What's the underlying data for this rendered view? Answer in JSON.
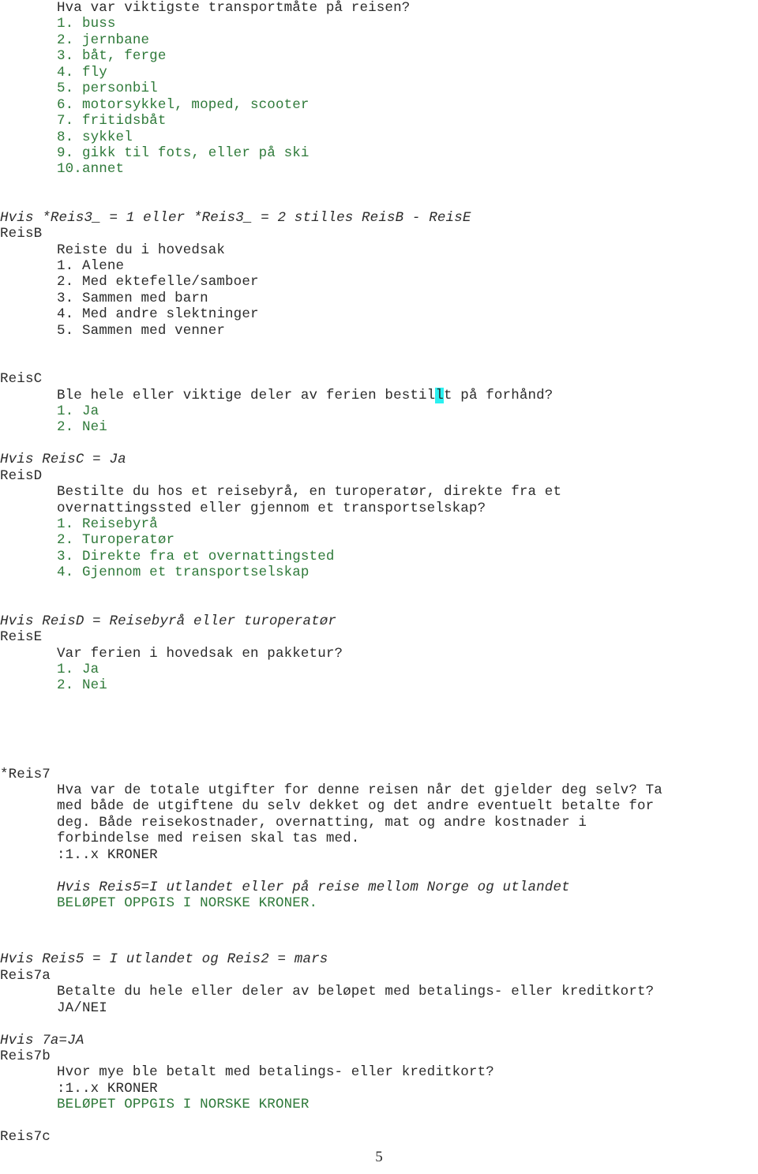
{
  "document": {
    "page_number": "5",
    "language": "no",
    "colors": {
      "text_dark": "#2b2b2b",
      "text_green": "#2f7a3a",
      "highlight_cyan": "#2bf0f0",
      "background": "#ffffff"
    }
  },
  "reisA_tail": {
    "question": "Hva var viktigste transportmåte på reisen?",
    "options": [
      "1. buss",
      "2. jernbane",
      "3. båt, ferge",
      "4. fly",
      "5. personbil",
      "6. motorsykkel, moped, scooter",
      "7. fritidsbåt",
      "8. sykkel",
      "9. gikk til fots, eller på ski",
      "10.annet"
    ]
  },
  "reisB": {
    "condition": "Hvis *Reis3_ = 1 eller *Reis3_ = 2 stilles ReisB - ReisE",
    "label": "ReisB",
    "question": "Reiste du i hovedsak",
    "options": [
      "1. Alene",
      "2. Med ektefelle/samboer",
      "3. Sammen med barn",
      "4. Med andre slektninger",
      "5. Sammen med venner"
    ]
  },
  "reisC": {
    "label": "ReisC",
    "question_pre": "Ble hele eller viktige deler av ferien bestil",
    "question_highlight": "l",
    "question_post": "t på forhånd?",
    "options": [
      "1. Ja",
      "2. Nei"
    ]
  },
  "reisD": {
    "condition": "Hvis ReisC = Ja",
    "label": "ReisD",
    "question_line1": "Bestilte du hos et reisebyrå, en turoperatør, direkte fra et",
    "question_line2": "overnattingssted eller gjennom et transportselskap?",
    "options": [
      "1. Reisebyrå",
      "2. Turoperatør",
      "3. Direkte fra et overnattingsted",
      "4. Gjennom et transportselskap"
    ]
  },
  "reisE": {
    "condition": "Hvis ReisD = Reisebyrå eller turoperatør",
    "label": "ReisE",
    "question": "Var ferien i hovedsak en pakketur?",
    "options": [
      "1. Ja",
      "2. Nei"
    ]
  },
  "reis7": {
    "label": "*Reis7",
    "question_line1": "Hva var de totale utgifter for denne reisen når det gjelder deg selv? Ta",
    "question_line2": "med både de utgiftene du selv dekket og det andre eventuelt betalte for",
    "question_line3": "deg. Både reisekostnader, overnatting, mat og andre kostnader i",
    "question_line4": "forbindelse med reisen skal tas med.",
    "answer_format": ":1..x KRONER",
    "condition_note": "Hvis Reis5=I utlandet eller på reise mellom Norge og utlandet",
    "instruction": "BELØPET OPPGIS I NORSKE KRONER."
  },
  "reis7a": {
    "condition": "Hvis Reis5 = I utlandet og Reis2 = mars",
    "label": "Reis7a",
    "question": "Betalte du hele eller deler av beløpet med betalings- eller kreditkort?",
    "answer_format": "JA/NEI"
  },
  "reis7b": {
    "condition": "Hvis 7a=JA",
    "label": "Reis7b",
    "question": "Hvor mye ble betalt med betalings- eller kreditkort?",
    "answer_format": ":1..x KRONER",
    "instruction": "BELØPET OPPGIS I NORSKE KRONER"
  },
  "reis7c": {
    "label": "Reis7c"
  }
}
